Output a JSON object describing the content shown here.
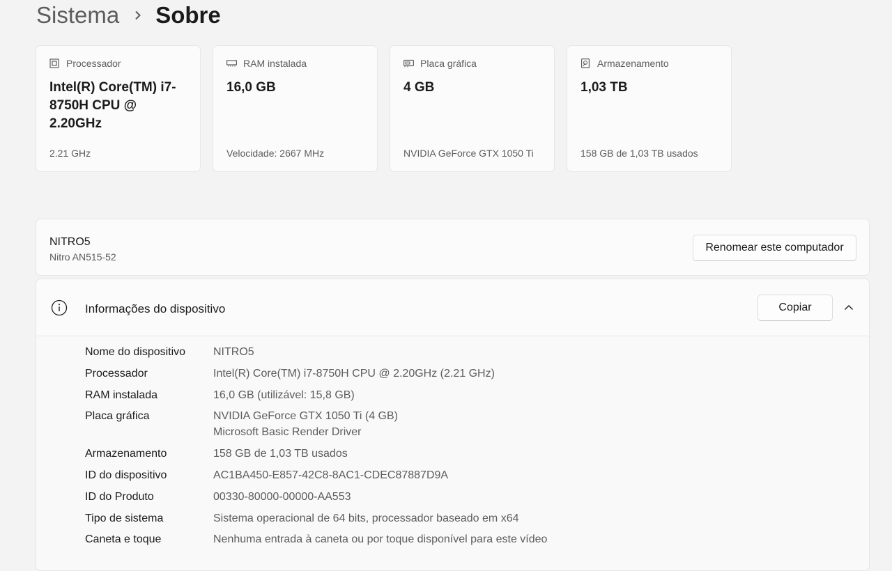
{
  "breadcrumb": {
    "parent": "Sistema",
    "separator": "›",
    "current": "Sobre"
  },
  "specs": [
    {
      "label": "Processador",
      "value": "Intel(R) Core(TM) i7-8750H CPU @ 2.20GHz",
      "sub": "2.21 GHz",
      "icon": "processor-icon"
    },
    {
      "label": "RAM instalada",
      "value": "16,0 GB",
      "sub": "Velocidade: 2667 MHz",
      "icon": "ram-icon"
    },
    {
      "label": "Placa gráfica",
      "value": "4 GB",
      "sub": "NVIDIA GeForce GTX 1050 Ti",
      "icon": "graphics-card-icon"
    },
    {
      "label": "Armazenamento",
      "value": "1,03 TB",
      "sub": "158 GB de 1,03 TB usados",
      "icon": "storage-icon"
    }
  ],
  "device": {
    "name": "NITRO5",
    "model": "Nitro AN515-52",
    "rename_label": "Renomear este computador"
  },
  "info": {
    "title": "Informações do dispositivo",
    "copy_label": "Copiar",
    "rows": [
      {
        "label": "Nome do dispositivo",
        "value": [
          "NITRO5"
        ]
      },
      {
        "label": "Processador",
        "value": [
          "Intel(R) Core(TM) i7-8750H CPU @ 2.20GHz (2.21 GHz)"
        ]
      },
      {
        "label": "RAM instalada",
        "value": [
          "16,0 GB (utilizável: 15,8 GB)"
        ]
      },
      {
        "label": "Placa gráfica",
        "value": [
          "NVIDIA GeForce GTX 1050 Ti (4 GB)",
          "Microsoft Basic Render Driver"
        ]
      },
      {
        "label": "Armazenamento",
        "value": [
          "158 GB de 1,03 TB usados"
        ]
      },
      {
        "label": "ID do dispositivo",
        "value": [
          "AC1BA450-E857-42C8-8AC1-CDEC87887D9A"
        ]
      },
      {
        "label": "ID do Produto",
        "value": [
          "00330-80000-00000-AA553"
        ]
      },
      {
        "label": "Tipo de sistema",
        "value": [
          "Sistema operacional de 64 bits, processador baseado em x64"
        ]
      },
      {
        "label": "Caneta e toque",
        "value": [
          "Nenhuma entrada à caneta ou por toque disponível para este vídeo"
        ]
      }
    ]
  }
}
